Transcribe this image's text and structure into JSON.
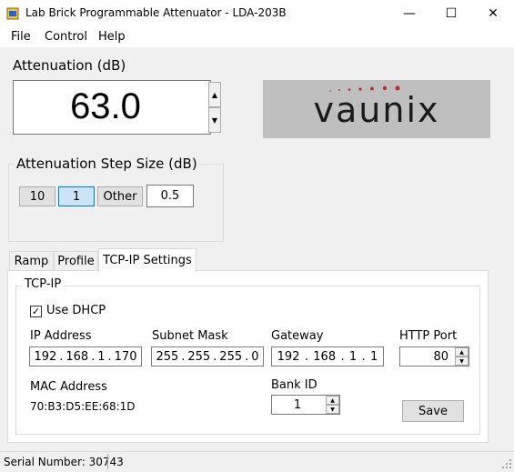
{
  "window": {
    "title": "Lab Brick Programmable Attenuator - LDA-203B",
    "minimize": "—",
    "maximize": "☐",
    "close": "✕"
  },
  "menu": [
    "File",
    "Control",
    "Help"
  ],
  "attenuation": {
    "label": "Attenuation (dB)",
    "value": "63.0",
    "up": "▲",
    "down": "▼"
  },
  "logo": {
    "text": "vaunix",
    "accent_color": "#c0272d",
    "text_color": "#1a1a1a"
  },
  "step_size": {
    "label": "Attenuation Step Size (dB)",
    "buttons": [
      "10",
      "1",
      "Other"
    ],
    "selected": "1",
    "other_value": "0.5"
  },
  "tabs": [
    "Ramp",
    "Profile",
    "TCP-IP Settings"
  ],
  "active_tab": "TCP-IP Settings",
  "tcpip": {
    "group_label": "TCP-IP",
    "use_dhcp_label": "Use DHCP",
    "use_dhcp_checked": true,
    "ip_label": "IP Address",
    "ip": [
      "192",
      "168",
      "1",
      "170"
    ],
    "subnet_label": "Subnet Mask",
    "subnet": [
      "255",
      "255",
      "255",
      "0"
    ],
    "gateway_label": "Gateway",
    "gateway": [
      "192",
      "168",
      "1",
      "1"
    ],
    "http_port_label": "HTTP Port",
    "http_port": "80",
    "mac_label": "MAC Address",
    "mac": "70:B3:D5:EE:68:1D",
    "bank_label": "Bank ID",
    "bank_id": "1",
    "save_label": "Save"
  },
  "status": {
    "serial": "Serial Number: 30743"
  }
}
